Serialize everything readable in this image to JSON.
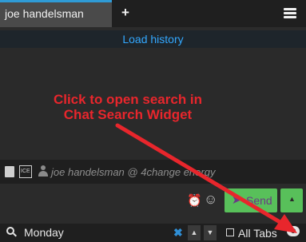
{
  "tabs": {
    "active_label": "joe handelsman",
    "add_icon": "plus-icon",
    "menu_icon": "hamburger-menu-icon"
  },
  "history": {
    "label": "Load history"
  },
  "overlay": {
    "line1": "Click to open search in",
    "line2": "Chat Search Widget",
    "color": "#e8262c"
  },
  "presence": {
    "text": "joe handelsman @ 4change energy",
    "icons": [
      "document-icon",
      "ice-icon",
      "user-icon"
    ],
    "ice_label": "ICE"
  },
  "compose": {
    "alarm_icon": "alarm-icon",
    "emoji_icon": "smiley-icon",
    "send_label": "Send",
    "send_color": "#58c05a"
  },
  "search": {
    "value": "Monday",
    "clear_icon": "x-icon",
    "all_tabs_label": "All Tabs",
    "all_tabs_checked": false,
    "chat_search_icon": "chat-search-icon"
  },
  "accent": {
    "tab": "#2f9bd6",
    "link": "#33a8ff"
  }
}
